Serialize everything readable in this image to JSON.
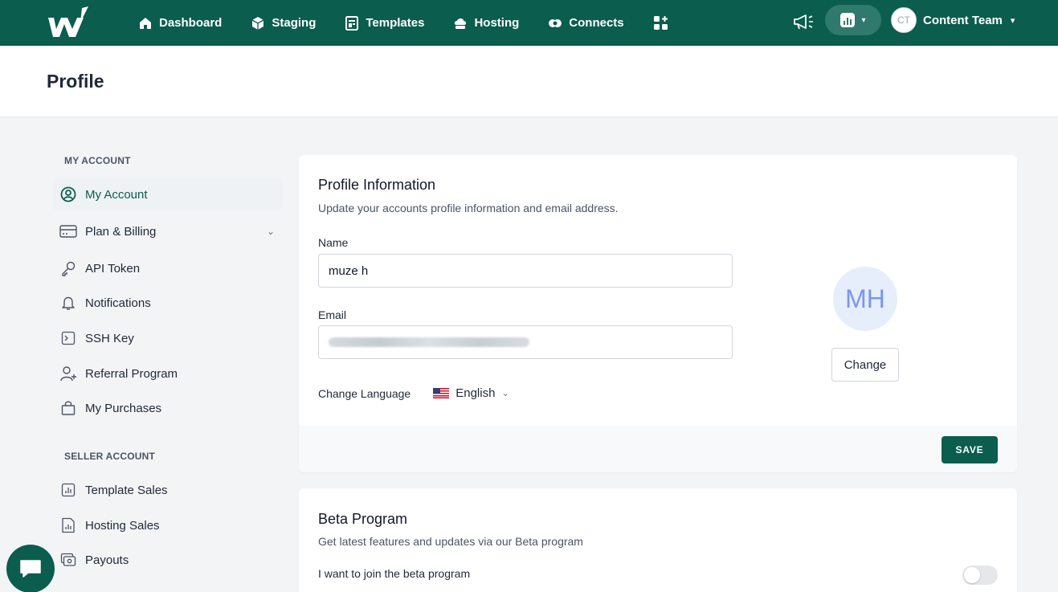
{
  "nav": {
    "items": [
      {
        "label": "Dashboard",
        "icon": "home-icon"
      },
      {
        "label": "Staging",
        "icon": "cube-icon"
      },
      {
        "label": "Templates",
        "icon": "templates-icon"
      },
      {
        "label": "Hosting",
        "icon": "cloud-icon"
      },
      {
        "label": "Connects",
        "icon": "connects-icon"
      }
    ],
    "user": {
      "initials": "CT",
      "name": "Content Team"
    }
  },
  "page": {
    "title": "Profile"
  },
  "sidebar": {
    "my_account_heading": "MY ACCOUNT",
    "seller_account_heading": "SELLER ACCOUNT",
    "items": [
      {
        "label": "My Account",
        "icon": "user-circle-icon",
        "active": true
      },
      {
        "label": "Plan & Billing",
        "icon": "credit-card-icon"
      },
      {
        "label": "API Token",
        "icon": "key-icon"
      },
      {
        "label": "Notifications",
        "icon": "bell-icon"
      },
      {
        "label": "SSH Key",
        "icon": "terminal-icon"
      },
      {
        "label": "Referral Program",
        "icon": "user-plus-icon"
      },
      {
        "label": "My Purchases",
        "icon": "shopping-bag-icon"
      }
    ],
    "seller_items": [
      {
        "label": "Template Sales",
        "icon": "chart-icon"
      },
      {
        "label": "Hosting Sales",
        "icon": "file-chart-icon"
      },
      {
        "label": "Payouts",
        "icon": "payout-icon"
      }
    ]
  },
  "profile": {
    "title": "Profile Information",
    "subtitle": "Update your accounts profile information and email address.",
    "name_label": "Name",
    "name_value": "muze h",
    "email_label": "Email",
    "language_label": "Change Language",
    "language_value": "English",
    "avatar_initials": "MH",
    "change_label": "Change",
    "save_label": "SAVE"
  },
  "beta": {
    "title": "Beta Program",
    "subtitle": "Get latest features and updates via our Beta program",
    "toggle_label": "I want to join the beta program",
    "enabled": false
  },
  "colors": {
    "brand": "#0b5d4e",
    "avatar_bg": "#e6edfb",
    "avatar_text": "#7b97e8"
  }
}
